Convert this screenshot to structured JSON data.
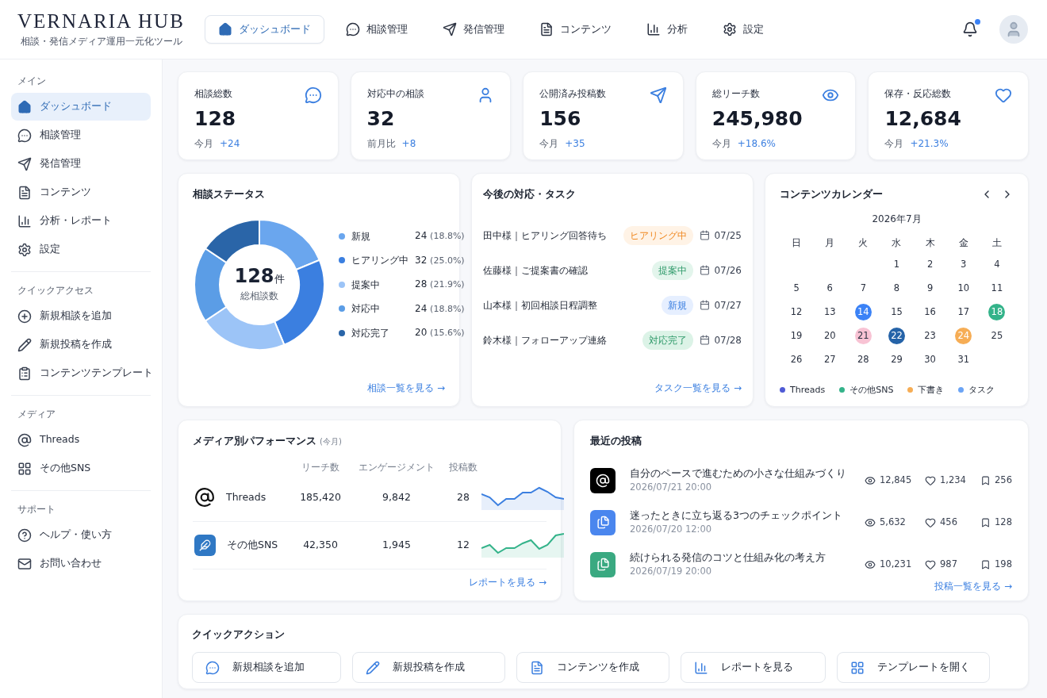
{
  "header": {
    "logo": "VERNARIA HUB",
    "tagline": "相談・発信メディア運用一元化ツール",
    "nav": [
      {
        "label": "ダッシュボード",
        "selected": true
      },
      {
        "label": "相談管理",
        "selected": false
      },
      {
        "label": "発信管理",
        "selected": false
      },
      {
        "label": "コンテンツ",
        "selected": false
      },
      {
        "label": "分析",
        "selected": false
      },
      {
        "label": "設定",
        "selected": false
      }
    ],
    "notifications_unread": true
  },
  "sidebar": {
    "sections": [
      {
        "title": "メイン",
        "items": [
          {
            "label": "ダッシュボード",
            "selected": true
          },
          {
            "label": "相談管理",
            "selected": false
          },
          {
            "label": "発信管理",
            "selected": false
          },
          {
            "label": "コンテンツ",
            "selected": false
          },
          {
            "label": "分析・レポート",
            "selected": false
          },
          {
            "label": "設定",
            "selected": false
          }
        ]
      },
      {
        "title": "クイックアクセス",
        "items": [
          {
            "label": "新規相談を追加",
            "selected": false
          },
          {
            "label": "新規投稿を作成",
            "selected": false
          },
          {
            "label": "コンテンツテンプレート",
            "selected": false
          }
        ]
      },
      {
        "title": "メディア",
        "items": [
          {
            "label": "Threads",
            "selected": false
          },
          {
            "label": "その他SNS",
            "selected": false
          }
        ]
      },
      {
        "title": "サポート",
        "items": [
          {
            "label": "ヘルプ・使い方",
            "selected": false
          },
          {
            "label": "お問い合わせ",
            "selected": false
          }
        ]
      }
    ]
  },
  "stats": [
    {
      "label": "相談総数",
      "value": "128",
      "period": "今月",
      "delta": "+24"
    },
    {
      "label": "対応中の相談",
      "value": "32",
      "period": "前月比",
      "delta": "+8"
    },
    {
      "label": "公開済み投稿数",
      "value": "156",
      "period": "今月",
      "delta": "+35"
    },
    {
      "label": "総リーチ数",
      "value": "245,980",
      "period": "今月",
      "delta": "+18.6%"
    },
    {
      "label": "保存・反応総数",
      "value": "12,684",
      "period": "今月",
      "delta": "+21.3%"
    }
  ],
  "status": {
    "title": "相談ステータス",
    "center_value": "128",
    "center_unit": "件",
    "center_label": "総相談数",
    "legend": [
      {
        "reading": "24",
        "percent": "(18.8%)",
        "color": "#6aa6ee"
      },
      {
        "reading": "32",
        "percent": "(25.0%)",
        "color": "#3b7fe0"
      },
      {
        "reading": "28",
        "percent": "(21.9%)",
        "color": "#9cc4f7"
      },
      {
        "reading": "24",
        "percent": "(18.8%)",
        "color": "#5b9de6"
      },
      {
        "reading": "20",
        "percent": "(15.6%)",
        "color": "#2a65a8"
      }
    ],
    "chart_data": {
      "type": "donut",
      "categories": [
        "新規",
        "ヒアリング中",
        "提案中",
        "対応中",
        "対応完了"
      ],
      "values": [
        18.8,
        25.0,
        21.9,
        18.8,
        15.6
      ]
    },
    "link": "相談一覧を見る →"
  },
  "tasks": {
    "title": "今後の対応・タスク",
    "items": [
      {
        "text": "田中様｜ヒアリング回答待ち",
        "badge": "ヒアリング中",
        "kind": "hearing",
        "date": "07/25"
      },
      {
        "text": "佐藤様｜ご提案書の確認",
        "badge": "提案中",
        "kind": "proposal",
        "date": "07/26"
      },
      {
        "text": "山本様｜初回相談日程調整",
        "badge": "新規",
        "kind": "new",
        "date": "07/27"
      },
      {
        "text": "鈴木様｜フォローアップ連絡",
        "badge": "対応完了",
        "kind": "done",
        "date": "07/28"
      }
    ],
    "link": "タスク一覧を見る →"
  },
  "calendar": {
    "title": "コンテンツカレンダー",
    "month": "2026年7月",
    "weekdays": [
      "日",
      "月",
      "火",
      "水",
      "木",
      "金",
      "土"
    ],
    "weeks": [
      [
        {
          "day": "1"
        },
        {
          "day": "2"
        },
        {
          "day": "3"
        },
        {
          "day": "4"
        }
      ],
      [
        {
          "day": "5"
        },
        {
          "day": "6"
        },
        {
          "day": "7"
        },
        {
          "day": "8"
        },
        {
          "day": "9"
        },
        {
          "day": "10"
        },
        {
          "day": "11"
        }
      ],
      [
        {
          "day": "12"
        },
        {
          "day": "13"
        },
        {
          "day": "14",
          "color": "#3b82f6"
        },
        {
          "day": "15"
        },
        {
          "day": "16"
        },
        {
          "day": "17"
        },
        {
          "day": "18",
          "color": "#34b38a"
        }
      ],
      [
        {
          "day": "19"
        },
        {
          "day": "20"
        },
        {
          "day": "21",
          "color": "#f8c3d4"
        },
        {
          "day": "22",
          "color": "#2563a8"
        },
        {
          "day": "23"
        },
        {
          "day": "24",
          "color": "#f6ad55"
        },
        {
          "day": "25"
        }
      ],
      [
        {
          "day": "26"
        },
        {
          "day": "27"
        },
        {
          "day": "28"
        },
        {
          "day": "29"
        },
        {
          "day": "30"
        },
        {
          "day": "31"
        }
      ]
    ],
    "legend": [
      {
        "label": "Threads",
        "color": "#4f5bd5"
      },
      {
        "label": "その他SNS",
        "color": "#34b38a"
      },
      {
        "label": "下書き",
        "color": "#f6ad55"
      },
      {
        "label": "タスク",
        "color": "#6ba4f5"
      }
    ]
  },
  "media": {
    "title": "メディア別パフォーマンス",
    "subtitle": "(今月)",
    "columns": [
      "リーチ数",
      "エンゲージメント",
      "投稿数"
    ],
    "rows": [
      {
        "kind": "threads",
        "name": "Threads",
        "reach": "185,420",
        "engagement": "9,842",
        "posts": "28",
        "color": "#3b7fe0"
      },
      {
        "kind": "sns",
        "name": "その他SNS",
        "reach": "42,350",
        "engagement": "1,945",
        "posts": "12",
        "color": "#34b38a"
      }
    ],
    "link": "レポートを見る →"
  },
  "posts": {
    "title": "最近の投稿",
    "items": [
      {
        "kind": "threads",
        "title": "自分のペースで進むための小さな仕組みづくり",
        "date": "2026/07/21 20:00",
        "views": "12,845",
        "likes": "1,234",
        "saves": "256"
      },
      {
        "kind": "doc-blue",
        "title": "迷ったときに立ち返る3つのチェックポイント",
        "date": "2026/07/20 12:00",
        "views": "5,632",
        "likes": "456",
        "saves": "128"
      },
      {
        "kind": "doc-green",
        "title": "続けられる発信のコツと仕組み化の考え方",
        "date": "2026/07/19 20:00",
        "views": "10,231",
        "likes": "987",
        "saves": "198"
      }
    ],
    "link": "投稿一覧を見る →"
  },
  "quick_actions": {
    "title": "クイックアクション",
    "buttons": [
      "新規相談を追加",
      "新規投稿を作成",
      "コンテンツを作成",
      "レポートを見る",
      "テンプレートを開く"
    ]
  }
}
